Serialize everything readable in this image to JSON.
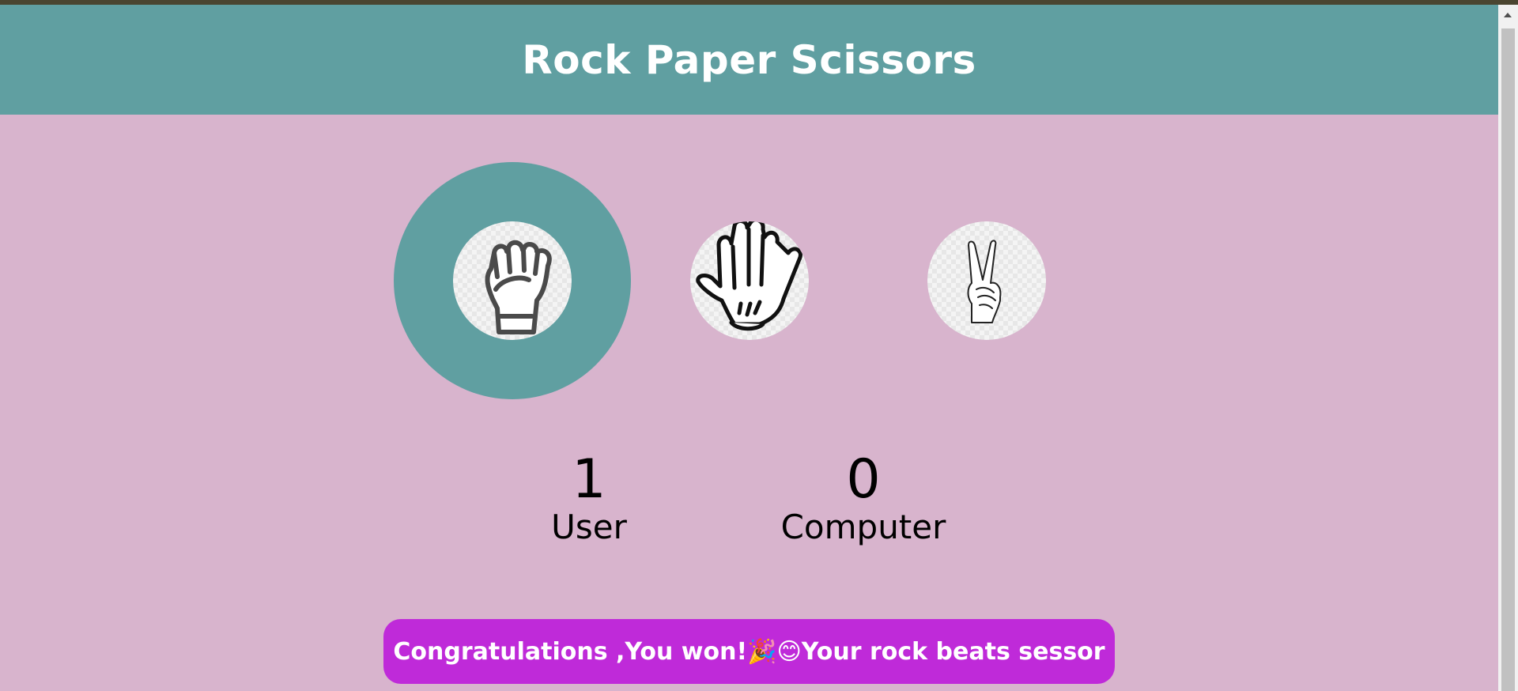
{
  "header": {
    "title": "Rock Paper Scissors"
  },
  "colors": {
    "header_bg": "#609fa1",
    "page_bg": "#d8b4cd",
    "highlight": "#609fa1",
    "message_bg": "#bf2ad9"
  },
  "choices": [
    {
      "id": "rock",
      "icon": "rock-fist-icon",
      "selected": true
    },
    {
      "id": "paper",
      "icon": "paper-hand-icon",
      "selected": false
    },
    {
      "id": "scissors",
      "icon": "scissors-hand-icon",
      "selected": false
    }
  ],
  "scores": {
    "user": {
      "value": "1",
      "label": "User"
    },
    "computer": {
      "value": "0",
      "label": "Computer"
    }
  },
  "message": {
    "text": "Congratulations ,You won!🎉😊Your rock beats sessor"
  }
}
